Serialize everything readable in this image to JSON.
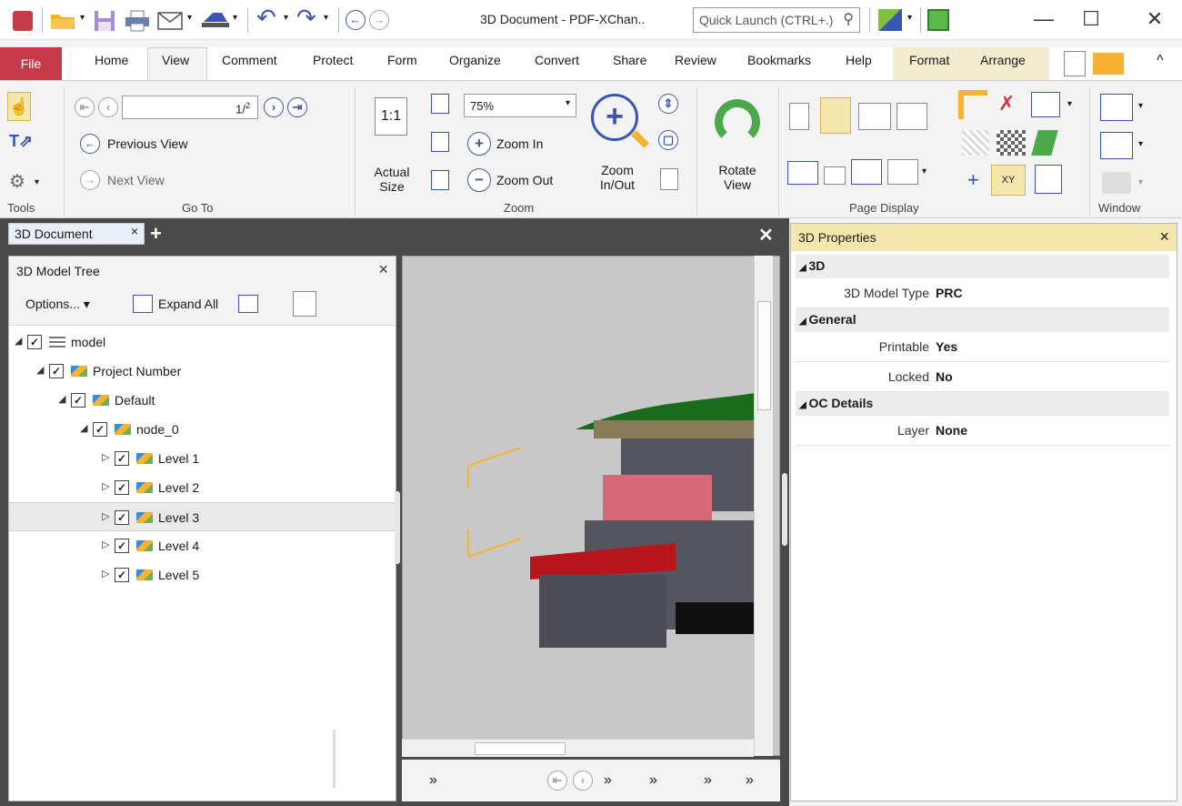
{
  "titlebar": {
    "title": "3D Document - PDF-XChan..",
    "quick_launch_placeholder": "Quick Launch (CTRL+.)"
  },
  "menu": {
    "tabs": [
      "File",
      "Home",
      "View",
      "Comment",
      "Protect",
      "Form",
      "Organize",
      "Convert",
      "Share",
      "Review",
      "Bookmarks",
      "Help",
      "Format",
      "Arrange"
    ],
    "active_tab": "View"
  },
  "ribbon": {
    "tools_label": "Tools",
    "goto": {
      "page_value": "1",
      "page_total": "2",
      "previous_view": "Previous View",
      "next_view": "Next View",
      "group_label": "Go To"
    },
    "zoom": {
      "actual_size": "Actual Size",
      "zoom_value": "75%",
      "zoom_in": "Zoom In",
      "zoom_out": "Zoom Out",
      "zoom_inout": "Zoom In/Out",
      "group_label": "Zoom"
    },
    "rotate": {
      "label": "Rotate View"
    },
    "page_display_label": "Page Display",
    "window_label": "Window"
  },
  "document_tab": {
    "label": "3D Document"
  },
  "model_tree": {
    "title": "3D Model Tree",
    "options_label": "Options...",
    "expand_all_label": "Expand All",
    "nodes": [
      {
        "label": "model",
        "depth": 0,
        "expanded": true,
        "icon": "tree-icon"
      },
      {
        "label": "Project Number",
        "depth": 1,
        "expanded": true,
        "icon": "shapes-icon"
      },
      {
        "label": "Default",
        "depth": 2,
        "expanded": true,
        "icon": "shapes-icon"
      },
      {
        "label": "node_0",
        "depth": 3,
        "expanded": true,
        "icon": "shapes-icon"
      },
      {
        "label": "Level 1",
        "depth": 4,
        "expanded": false,
        "icon": "shapes-icon"
      },
      {
        "label": "Level 2",
        "depth": 4,
        "expanded": false,
        "icon": "shapes-icon"
      },
      {
        "label": "Level 3",
        "depth": 4,
        "expanded": false,
        "icon": "shapes-icon",
        "selected": true
      },
      {
        "label": "Level 4",
        "depth": 4,
        "expanded": false,
        "icon": "shapes-icon"
      },
      {
        "label": "Level 5",
        "depth": 4,
        "expanded": false,
        "icon": "shapes-icon"
      }
    ]
  },
  "properties": {
    "title": "3D Properties",
    "sections": [
      {
        "name": "3D",
        "rows": [
          {
            "key": "3D Model Type",
            "value": "PRC"
          }
        ]
      },
      {
        "name": "General",
        "rows": [
          {
            "key": "Printable",
            "value": "Yes"
          },
          {
            "key": "Locked",
            "value": "No"
          }
        ]
      },
      {
        "name": "OC Details",
        "rows": [
          {
            "key": "Layer",
            "value": "None"
          }
        ]
      }
    ]
  },
  "colors": {
    "file_tab": "#c63a49",
    "accent_blue": "#3a56b5",
    "props_header": "#f5e6ad",
    "workspace": "#4a4a4a"
  }
}
